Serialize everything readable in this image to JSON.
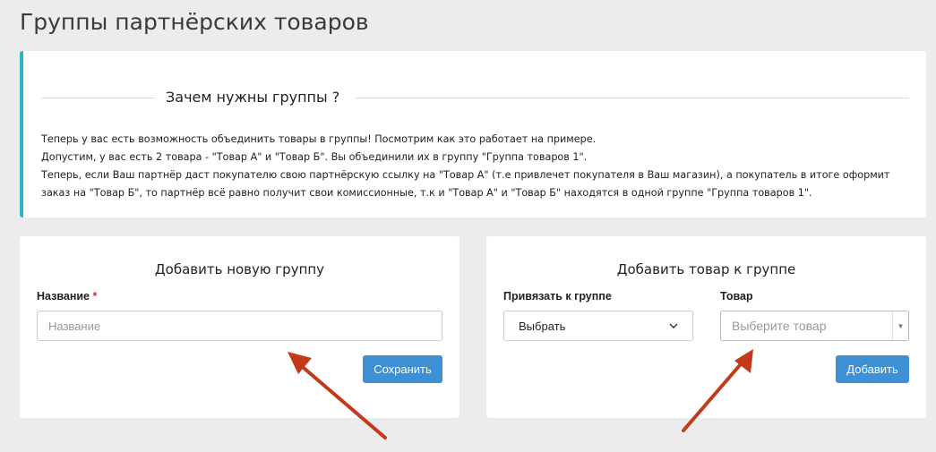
{
  "page": {
    "title": "Группы партнёрских товаров"
  },
  "info": {
    "heading": "Зачем нужны группы ?",
    "lines": [
      "Теперь у вас есть возможность объединить товары в группы! Посмотрим как это работает на примере.",
      "Допустим, у вас есть 2 товара - \"Товар А\" и \"Товар Б\". Вы объединили их в группу \"Группа товаров 1\".",
      "Теперь, если Ваш партнёр даст покупателю свою партнёрскую ссылку на \"Товар А\" (т.е привлечет покупателя в Ваш магазин), а покупатель в итоге оформит",
      "заказ на \"Товар Б\", то партнёр всё равно получит свои комиссионные, т.к и \"Товар А\" и \"Товар Б\" находятся в одной группе \"Группа товаров 1\"."
    ],
    "accent_color": "#2bb3c6"
  },
  "add_group": {
    "title": "Добавить новую группу",
    "name_label": "Название",
    "required_mark": "*",
    "name_placeholder": "Название",
    "save_label": "Сохранить"
  },
  "add_product": {
    "title": "Добавить товар к группе",
    "group_label": "Привязать к группе",
    "group_selected": "Выбрать",
    "product_label": "Товар",
    "product_placeholder": "Выберите товар",
    "add_label": "Добавить"
  },
  "colors": {
    "button": "#3d8fd6",
    "annotation_arrow": "#c23a1a",
    "required": "#d9302c"
  },
  "icons": {
    "group_select": "chevron-down-icon",
    "product_select": "caret-down-icon",
    "annotation": "arrow-annotation"
  }
}
